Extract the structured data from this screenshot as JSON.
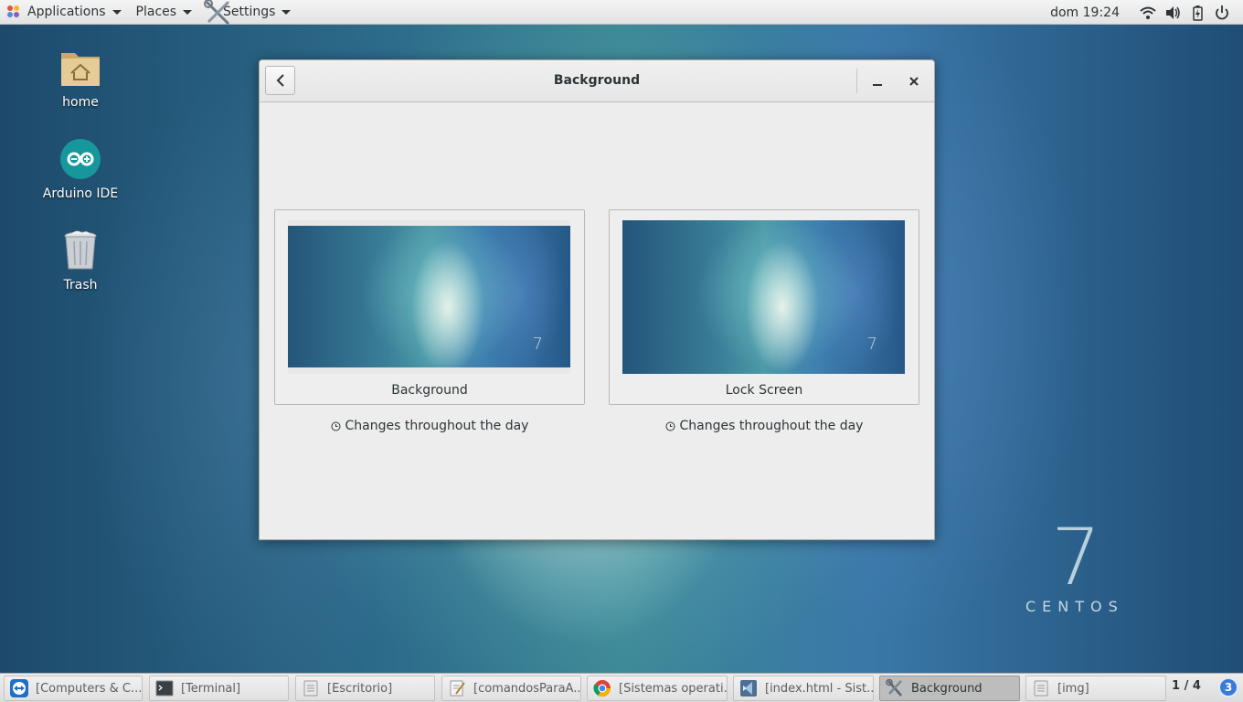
{
  "topbar": {
    "applications": "Applications",
    "places": "Places",
    "settings": "Settings",
    "clock": "dom 19:24",
    "tray_icons": [
      "wifi-icon",
      "volume-icon",
      "battery-icon",
      "power-menu-icon"
    ]
  },
  "desktop": {
    "icons": [
      {
        "label": "home",
        "icon": "home-folder-icon"
      },
      {
        "label": "Arduino IDE",
        "icon": "arduino-icon"
      },
      {
        "label": "Trash",
        "icon": "trash-icon"
      }
    ],
    "watermark": {
      "number": "7",
      "text": "CENTOS"
    }
  },
  "dialog": {
    "title": "Background",
    "tiles": [
      {
        "label": "Background",
        "caption": "Changes throughout the day"
      },
      {
        "label": "Lock Screen",
        "caption": "Changes throughout the day"
      }
    ]
  },
  "taskbar": {
    "tasks": [
      {
        "label": "[Computers & C...",
        "icon": "teamviewer-icon",
        "active": false
      },
      {
        "label": "[Terminal]",
        "icon": "terminal-icon",
        "active": false
      },
      {
        "label": "[Escritorio]",
        "icon": "file-manager-icon",
        "active": false
      },
      {
        "label": "[comandosParaA...",
        "icon": "text-editor-icon",
        "active": false
      },
      {
        "label": "[Sistemas operati...",
        "icon": "chrome-icon",
        "active": false
      },
      {
        "label": "[index.html - Sist...",
        "icon": "vscode-icon",
        "active": false
      },
      {
        "label": "Background",
        "icon": "settings-tools-icon",
        "active": true
      },
      {
        "label": "[img]",
        "icon": "file-manager-icon",
        "active": false
      }
    ],
    "pager": "1 / 4",
    "workspace_badge": "3"
  },
  "colors": {
    "accent": "#3b7bd8",
    "arduino": "#16979c",
    "panel": "#ededed"
  }
}
